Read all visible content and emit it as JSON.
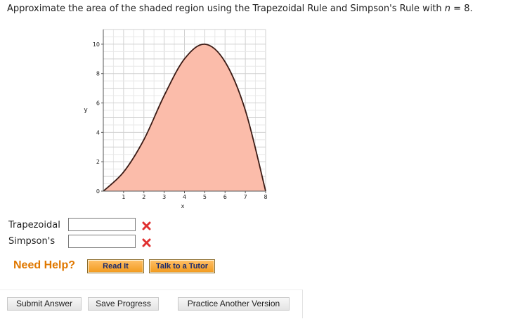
{
  "question": {
    "text_before": "Approximate the area of the shaded region using the Trapezoidal Rule and Simpson's Rule with ",
    "n_symbol": "n",
    "text_after": " = 8."
  },
  "chart_data": {
    "type": "area",
    "xlabel": "x",
    "ylabel": "y",
    "xlim": [
      0,
      8
    ],
    "ylim": [
      0,
      11
    ],
    "x_ticks": [
      "1",
      "2",
      "3",
      "4",
      "5",
      "6",
      "7",
      "8"
    ],
    "y_ticks": [
      "0",
      "2",
      "4",
      "6",
      "8",
      "10"
    ],
    "grid": true,
    "series": [
      {
        "x": [
          0,
          1,
          2,
          3,
          4,
          5,
          6,
          7,
          8
        ],
        "y": [
          0,
          1.3,
          3.5,
          6.5,
          9.0,
          10.0,
          8.8,
          5.5,
          0
        ]
      }
    ],
    "fill_color": "#fbbcaa",
    "line_color": "#3a1a14"
  },
  "rows": [
    {
      "label": "Trapezoidal",
      "value": "",
      "status": "incorrect"
    },
    {
      "label": "Simpson's",
      "value": "",
      "status": "incorrect"
    }
  ],
  "help": {
    "label": "Need Help?",
    "read_it": "Read It",
    "talk_to_tutor": "Talk to a Tutor"
  },
  "actions": {
    "submit": "Submit Answer",
    "save": "Save Progress",
    "practice": "Practice Another Version"
  },
  "colors": {
    "accent": "#e07800",
    "incorrect": "#e03030"
  }
}
